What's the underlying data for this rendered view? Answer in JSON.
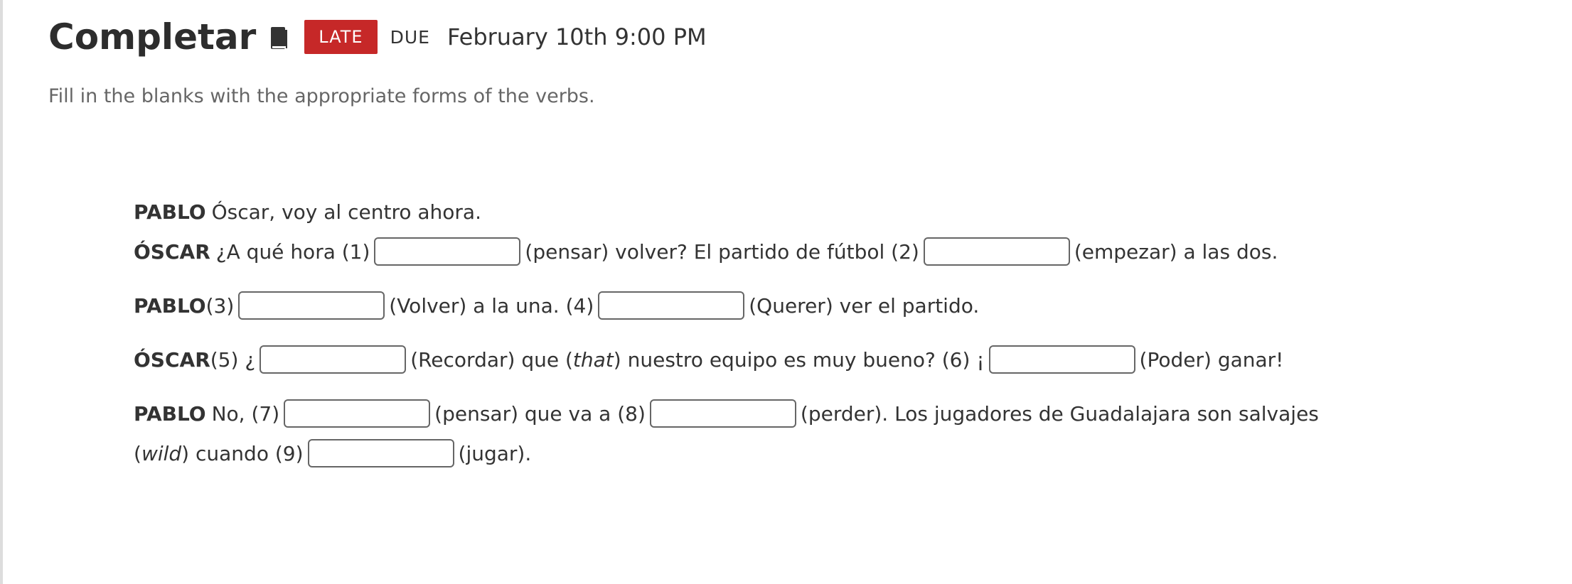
{
  "header": {
    "title": "Completar",
    "status_badge": "LATE",
    "due_label": "DUE",
    "due_date": "February 10th 9:00 PM"
  },
  "instructions": "Fill in the blanks with the appropriate forms of the verbs.",
  "dialogue": {
    "line1": {
      "speaker": "PABLO",
      "text": "Óscar, voy al centro ahora."
    },
    "line2": {
      "speaker": "ÓSCAR",
      "t1": "¿A qué hora (1)",
      "t2": "(pensar) volver? El partido de fútbol (2)",
      "t3": "(empezar) a las dos."
    },
    "line3": {
      "speaker": "PABLO",
      "t1": "(3)",
      "t2": "(Volver) a la una. (4)",
      "t3": "(Querer) ver el partido."
    },
    "line4": {
      "speaker": "ÓSCAR",
      "t1": "(5) ¿",
      "t2": "(Recordar) que (",
      "t2_italic": "that",
      "t2b": ") nuestro equipo es muy bueno? (6) ¡",
      "t3": "(Poder) ganar!"
    },
    "line5": {
      "speaker": "PABLO",
      "t1": "No, (7)",
      "t2": "(pensar) que va a (8)",
      "t3": "(perder). Los jugadores de Guadalajara son salvajes"
    },
    "line6": {
      "t0": "(",
      "t0_italic": "wild",
      "t1": ") cuando (9)",
      "t2": "(jugar)."
    }
  },
  "blanks": [
    {
      "number": "1",
      "value": ""
    },
    {
      "number": "2",
      "value": ""
    },
    {
      "number": "3",
      "value": ""
    },
    {
      "number": "4",
      "value": ""
    },
    {
      "number": "5",
      "value": ""
    },
    {
      "number": "6",
      "value": ""
    },
    {
      "number": "7",
      "value": ""
    },
    {
      "number": "8",
      "value": ""
    },
    {
      "number": "9",
      "value": ""
    }
  ],
  "colors": {
    "late_badge": "#c62828",
    "title": "#2d2d2d",
    "body_text": "#333333",
    "instructions": "#666666"
  },
  "icons": {
    "assignment": "book-icon"
  }
}
